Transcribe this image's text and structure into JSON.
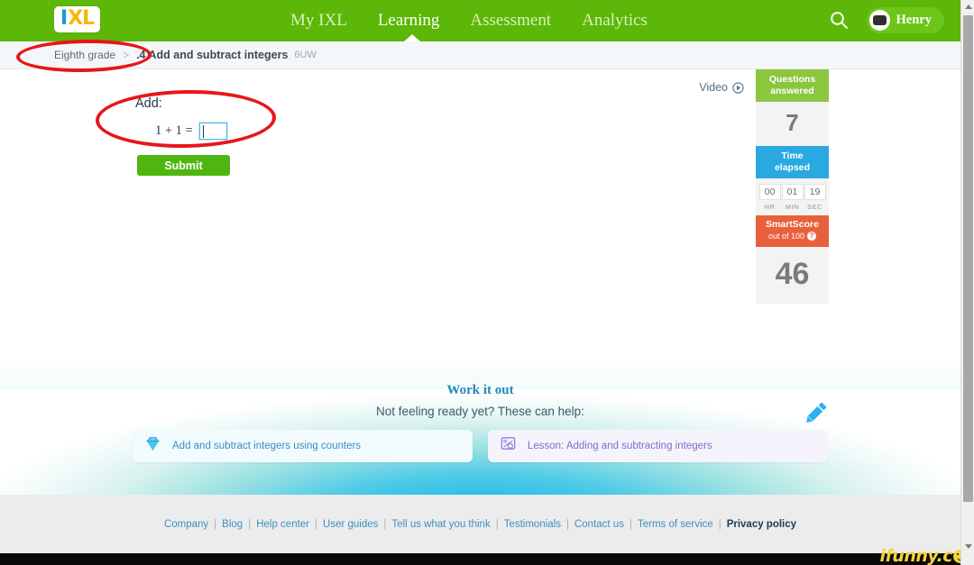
{
  "nav": {
    "logo_i": "I",
    "logo_xl": "XL",
    "links": [
      {
        "label": "My IXL",
        "active": false
      },
      {
        "label": "Learning",
        "active": true
      },
      {
        "label": "Assessment",
        "active": false
      },
      {
        "label": "Analytics",
        "active": false
      }
    ],
    "search_icon": "search-icon",
    "username": "Henry"
  },
  "breadcrumb": {
    "grade": "Eighth grade",
    "separator": ">",
    "skill_title": ".4 Add and subtract integers",
    "skill_code": "6UW"
  },
  "main": {
    "video_label": "Video",
    "question_prompt": "Add:",
    "equation": "1 + 1 =",
    "answer_value": "",
    "submit_label": "Submit",
    "pencil_icon": "pencil-icon"
  },
  "score_panel": {
    "questions_head_line1": "Questions",
    "questions_head_line2": "answered",
    "questions_answered": "7",
    "time_head_line1": "Time",
    "time_head_line2": "elapsed",
    "timer": [
      {
        "value": "00",
        "unit": "HR"
      },
      {
        "value": "01",
        "unit": "MIN"
      },
      {
        "value": "19",
        "unit": "SEC"
      }
    ],
    "smartscore_title": "SmartScore",
    "smartscore_sub": "out of 100",
    "smartscore_help": "?",
    "smartscore_value": "46"
  },
  "workout": {
    "title": "Work it out",
    "subtitle": "Not feeling ready yet? These can help:",
    "cards": [
      {
        "label": "Add and subtract integers using counters",
        "icon": "diamond-icon",
        "style": "blue"
      },
      {
        "label": "Lesson: Adding and subtracting integers",
        "icon": "video-lesson-icon",
        "style": "purple"
      }
    ]
  },
  "footer": {
    "links": [
      {
        "label": "Company",
        "bold": false
      },
      {
        "label": "Blog",
        "bold": false
      },
      {
        "label": "Help center",
        "bold": false
      },
      {
        "label": "User guides",
        "bold": false
      },
      {
        "label": "Tell us what you think",
        "bold": false
      },
      {
        "label": "Testimonials",
        "bold": false
      },
      {
        "label": "Contact us",
        "bold": false
      },
      {
        "label": "Terms of service",
        "bold": false
      },
      {
        "label": "Privacy policy",
        "bold": true
      }
    ],
    "separator": "|"
  },
  "watermark": {
    "text": "ifunny.c"
  },
  "colors": {
    "nav_green": "#5cb708",
    "submit_green": "#4fb511",
    "questions_green": "#8cc63e",
    "time_blue": "#29a9e0",
    "smartscore_orange": "#e8613c",
    "annotation_red": "#e8161a",
    "link_blue": "#3d8fc4",
    "watermark_yellow": "#f5d33c"
  }
}
